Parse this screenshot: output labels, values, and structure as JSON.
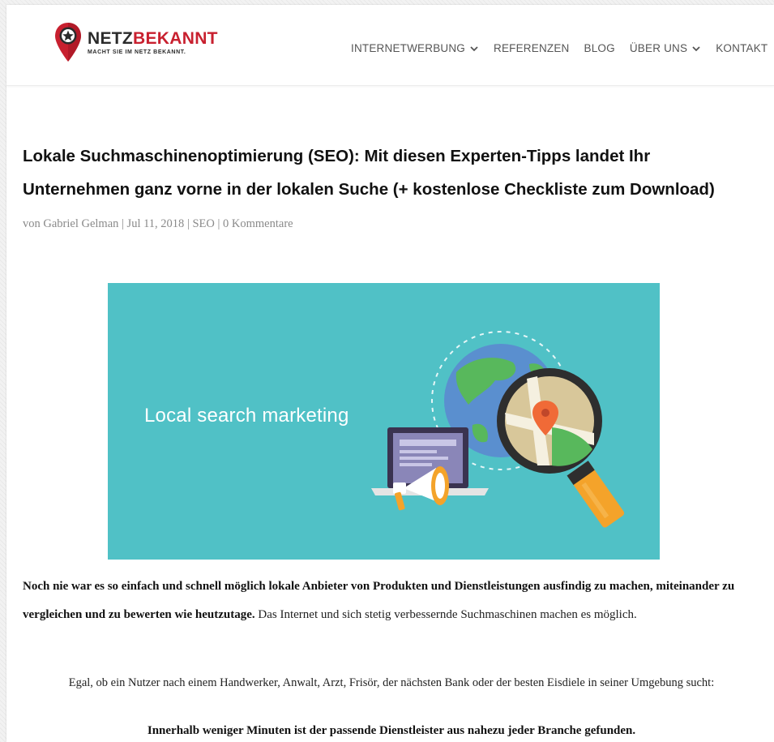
{
  "logo": {
    "name_part1": "NETZ",
    "name_part2": "BEKANNT",
    "slogan": "MACHT SIE IM NETZ BEKANNT.",
    "brand_color": "#c8202f"
  },
  "nav": {
    "items": [
      {
        "label": "INTERNETWERBUNG",
        "has_dropdown": true
      },
      {
        "label": "REFERENZEN",
        "has_dropdown": false
      },
      {
        "label": "BLOG",
        "has_dropdown": false
      },
      {
        "label": "ÜBER UNS",
        "has_dropdown": true
      },
      {
        "label": "KONTAKT",
        "has_dropdown": false
      }
    ]
  },
  "article": {
    "title_line1": "Lokale Suchmaschinenoptimierung (SEO): Mit diesen Experten-Tipps landet Ihr",
    "title_line2": "Unternehmen ganz vorne in der lokalen Suche (+ kostenlose Checkliste zum Download)",
    "meta": {
      "prefix": "von",
      "author": "Gabriel Gelman",
      "date": "Jul 11, 2018",
      "category": "SEO",
      "comments": "0 Kommentare",
      "separator": "|"
    },
    "hero": {
      "text": "Local search marketing",
      "bg_color": "#50c1c6"
    },
    "paragraph1_bold": "Noch nie war es so einfach und schnell möglich lokale Anbieter von Produkten und Dienstleistungen ausfindig zu machen, miteinander zu vergleichen und zu bewerten wie heutzutage.",
    "paragraph1_rest": " Das Internet und sich stetig verbessernde Suchmaschinen machen es möglich.",
    "paragraph2": "Egal, ob ein Nutzer nach einem Handwerker, Anwalt, Arzt, Frisör, der nächsten Bank oder der besten Eisdiele in seiner Umgebung sucht:",
    "paragraph3": "Innerhalb weniger Minuten ist der passende Dienstleister aus nahezu jeder Branche gefunden."
  },
  "icons": {
    "logo": "map-pin-star-icon",
    "dropdown": "chevron-down-icon",
    "hero_globe": "globe-icon",
    "hero_magnifier": "magnifier-icon",
    "hero_laptop": "laptop-icon",
    "hero_megaphone": "megaphone-icon",
    "hero_pin": "location-pin-icon"
  }
}
